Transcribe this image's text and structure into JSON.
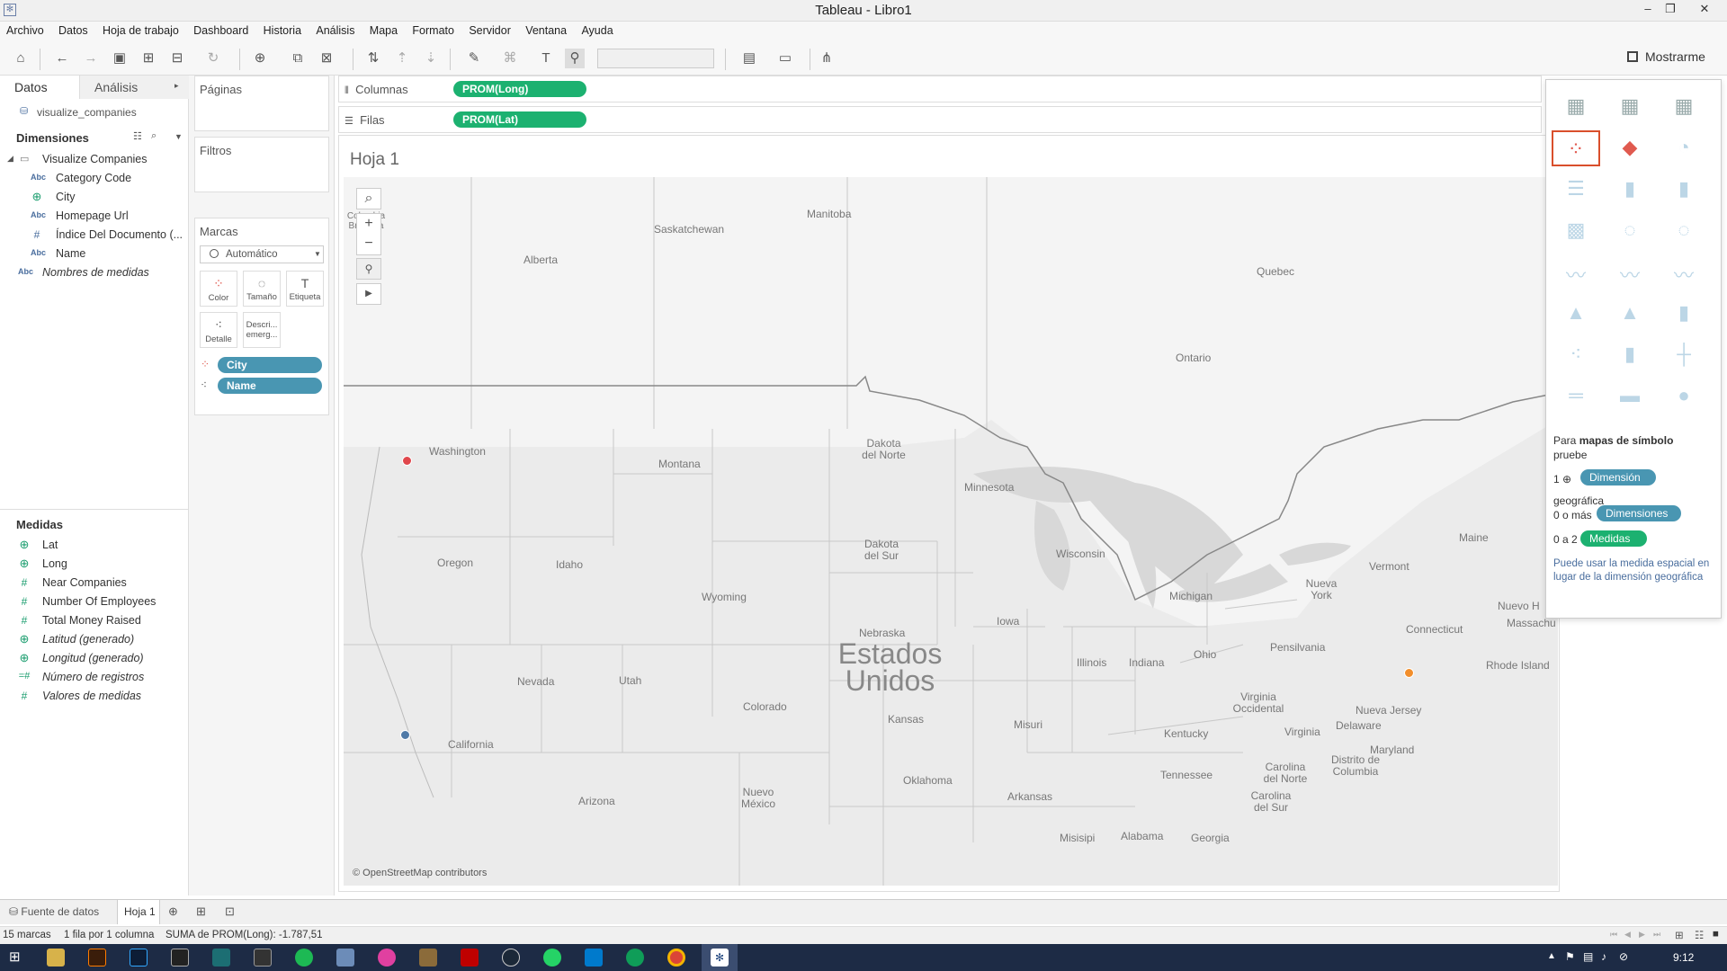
{
  "window": {
    "title": "Tableau - Libro1"
  },
  "menu": [
    "Archivo",
    "Datos",
    "Hoja de trabajo",
    "Dashboard",
    "Historia",
    "Análisis",
    "Mapa",
    "Formato",
    "Servidor",
    "Ventana",
    "Ayuda"
  ],
  "toolbar": {
    "show_me_label": "Mostrarme"
  },
  "datapane": {
    "tabs": [
      "Datos",
      "Análisis"
    ],
    "datasource": "visualize_companies",
    "dimensions_header": "Dimensiones",
    "folder": "Visualize Companies",
    "dimensions": [
      {
        "label": "Category Code",
        "type": "Abc"
      },
      {
        "label": "City",
        "type": "geo"
      },
      {
        "label": "Homepage Url",
        "type": "Abc"
      },
      {
        "label": "Índice Del Documento (...",
        "type": "#"
      },
      {
        "label": "Name",
        "type": "Abc"
      }
    ],
    "measure_names": "Nombres de medidas",
    "measures_header": "Medidas",
    "measures": [
      {
        "label": "Lat",
        "type": "geo",
        "italic": false
      },
      {
        "label": "Long",
        "type": "geo",
        "italic": false
      },
      {
        "label": "Near Companies",
        "type": "#",
        "italic": false
      },
      {
        "label": "Number Of Employees",
        "type": "#",
        "italic": false
      },
      {
        "label": "Total Money Raised",
        "type": "#",
        "italic": false
      },
      {
        "label": "Latitud (generado)",
        "type": "geo",
        "italic": true
      },
      {
        "label": "Longitud (generado)",
        "type": "geo",
        "italic": true
      },
      {
        "label": "Número de registros",
        "type": "=#",
        "italic": true
      },
      {
        "label": "Valores de medidas",
        "type": "#",
        "italic": true
      }
    ]
  },
  "shelves": {
    "pages": "Páginas",
    "filters": "Filtros",
    "marks": "Marcas",
    "mark_type": "Automático",
    "mark_buttons": [
      "Color",
      "Tamaño",
      "Etiqueta",
      "Detalle",
      "Descri... emerg..."
    ],
    "mark_pills": [
      "City",
      "Name"
    ],
    "columns_label": "Columnas",
    "columns_pill": "PROM(Long)",
    "rows_label": "Filas",
    "rows_pill": "PROM(Lat)"
  },
  "sheet": {
    "title": "Hoja 1"
  },
  "map": {
    "labels": [
      "Saskatchewan",
      "Manitoba",
      "Alberta",
      "Quebec",
      "Ontario",
      "Washington",
      "Montana",
      "Dakota del Norte",
      "Minnesota",
      "Oregon",
      "Idaho",
      "Dakota del Sur",
      "Wyoming",
      "Wisconsin",
      "Michigan",
      "Nueva York",
      "Vermont",
      "Maine",
      "Nuevo H",
      "Massachu",
      "Connecticut",
      "Rhode Island",
      "Pensilvania",
      "Nebraska",
      "Iowa",
      "Estados Unidos",
      "Illinois",
      "Indiana",
      "Ohio",
      "Nevada",
      "Utah",
      "Colorado",
      "Kansas",
      "Misuri",
      "Virginia Occidental",
      "Virginia",
      "Nueva Jersey",
      "Delaware",
      "Maryland",
      "Distrito de Columbia",
      "Kentucky",
      "California",
      "Oklahoma",
      "Tennessee",
      "Carolina del Norte",
      "Arkansas",
      "Carolina del Sur",
      "Arizona",
      "Nuevo México",
      "Misisipi",
      "Alabama",
      "Georgia",
      "Columbia Británica"
    ],
    "attribution": "© OpenStreetMap contributors",
    "points": [
      {
        "name": "Washington point",
        "color": "#e0474c"
      },
      {
        "name": "California point",
        "color": "#4e79a7"
      },
      {
        "name": "New York point",
        "color": "#f28e2b"
      }
    ]
  },
  "showme": {
    "intro1": "Para",
    "intro_bold": "mapas de símbolo",
    "intro2": "pruebe",
    "row1_count": "1",
    "row1_pill": "Dimensión",
    "row1_after": "geográfica",
    "row2_count": "0 o más",
    "row2_pill": "Dimensiones",
    "row3_count": "0 a 2",
    "row3_pill": "Medidas",
    "note": "Puede usar la medida espacial en lugar de la dimensión geográfica"
  },
  "tabs": {
    "datasource": "Fuente de datos",
    "sheet": "Hoja 1"
  },
  "status": {
    "marks": "15 marcas",
    "layout": "1 fila por 1 columna",
    "sum": "SUMA de PROM(Long): -1.787,51"
  },
  "taskbar": {
    "clock": "9:12"
  }
}
